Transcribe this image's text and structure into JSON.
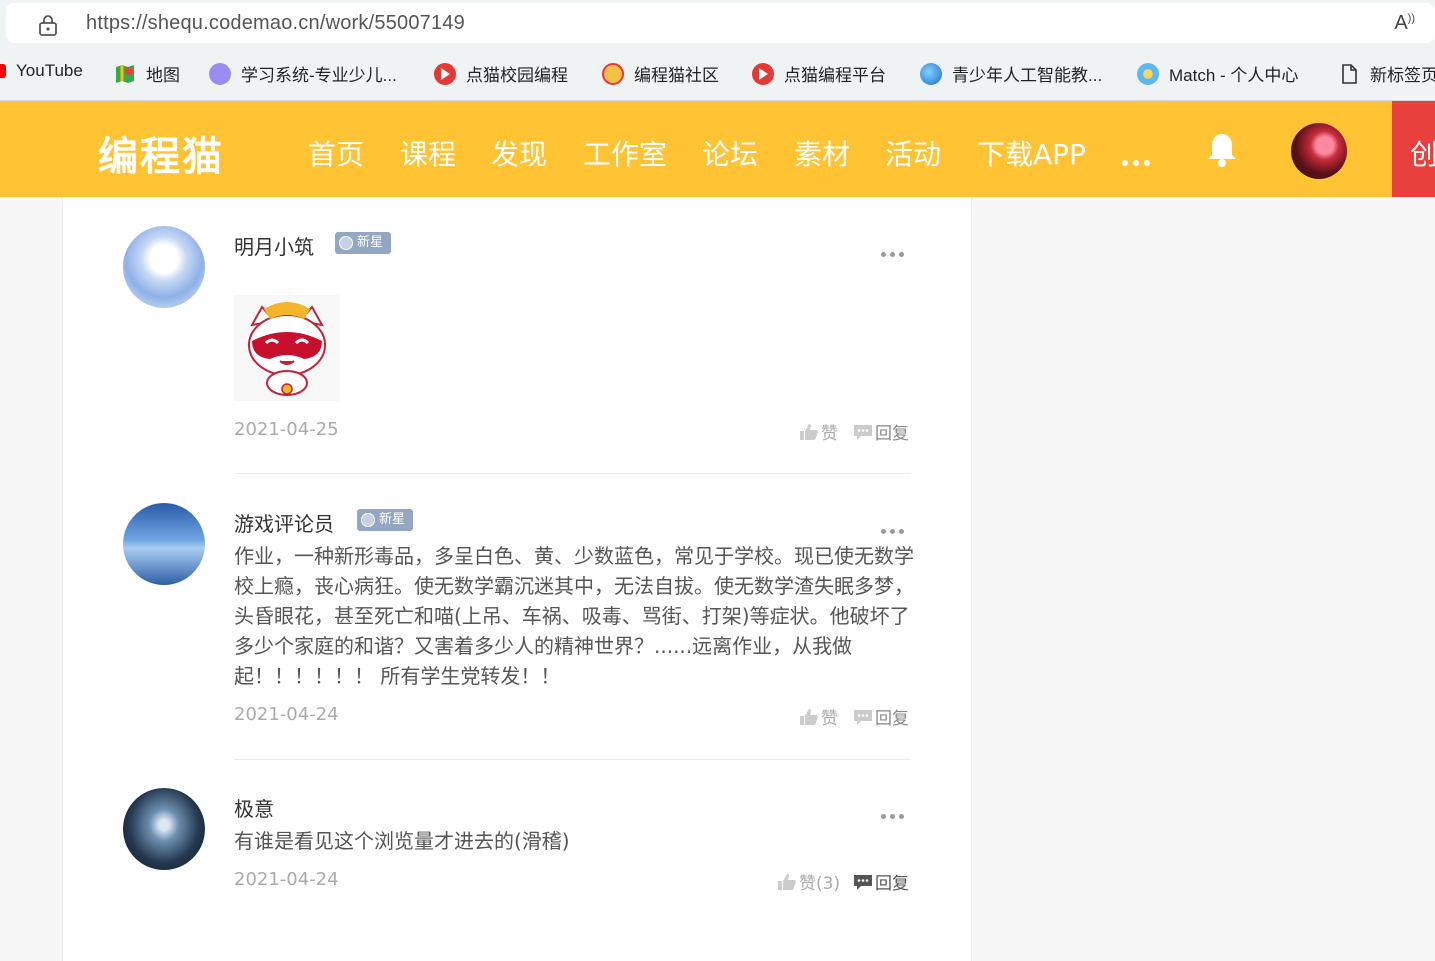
{
  "browser": {
    "url": "https://shequ.codemao.cn/work/55007149",
    "read_aloud": "A⁾"
  },
  "bookmarks": [
    {
      "label": "YouTube",
      "icon": "youtube-icon"
    },
    {
      "label": "地图",
      "icon": "maps-icon"
    },
    {
      "label": "学习系统-专业少儿...",
      "icon": "learning-system-icon"
    },
    {
      "label": "点猫校园编程",
      "icon": "codemao-icon"
    },
    {
      "label": "编程猫社区",
      "icon": "codemao-community-icon"
    },
    {
      "label": "点猫编程平台",
      "icon": "codemao-icon"
    },
    {
      "label": "青少年人工智能教...",
      "icon": "ai-edu-icon"
    },
    {
      "label": "Match - 个人中心",
      "icon": "match-icon"
    },
    {
      "label": "新标签页",
      "icon": "page-icon"
    }
  ],
  "nav": {
    "logo": "编程猫",
    "links": [
      "首页",
      "课程",
      "发现",
      "工作室",
      "论坛",
      "素材",
      "活动",
      "下载APP"
    ],
    "red_button": "创"
  },
  "comments": [
    {
      "name": "明月小筑",
      "badge": "新星",
      "text": "",
      "date": "2021-04-25",
      "like_label": "赞",
      "reply_label": "回复",
      "has_sticker": true
    },
    {
      "name": "游戏评论员",
      "badge": "新星",
      "text": "作业，一种新形毒品，多呈白色、黄、少数蓝色，常见于学校。现已使无数学校上瘾，丧心病狂。使无数学霸沉迷其中，无法自拔。使无数学渣失眠多梦，头昏眼花，甚至死亡和喵(上吊、车祸、吸毒、骂街、打架)等症状。他破坏了多少个家庭的和谐？又害着多少人的精神世界？......远离作业，从我做起！！！！！！ 所有学生党转发！！",
      "date": "2021-04-24",
      "like_label": "赞",
      "reply_label": "回复"
    },
    {
      "name": "极意",
      "badge": "",
      "text": "有谁是看见这个浏览量才进去的(滑稽)",
      "date": "2021-04-24",
      "like_label": "赞(3)",
      "reply_label": "回复"
    }
  ]
}
